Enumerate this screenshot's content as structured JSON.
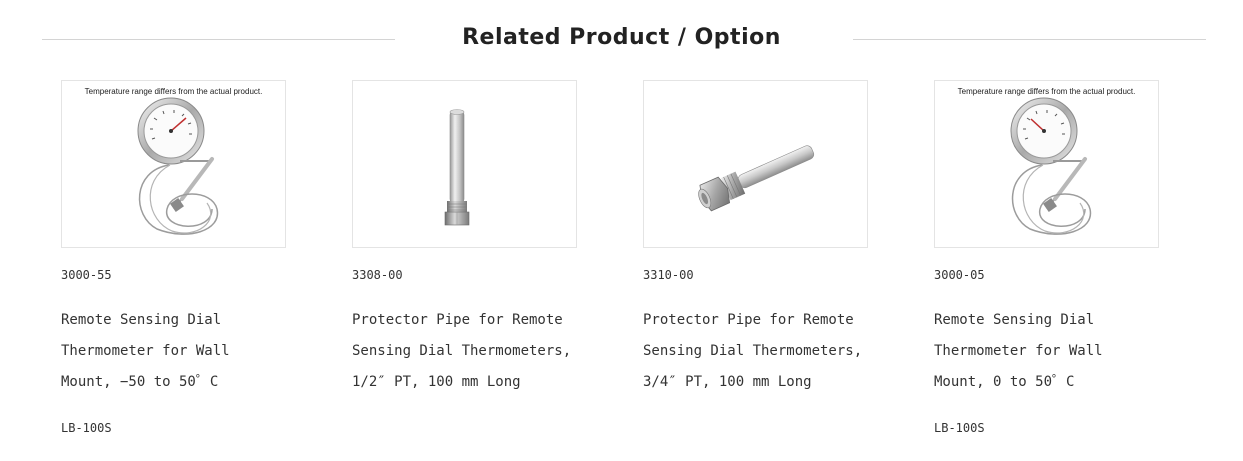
{
  "section": {
    "title": "Related Product / Option"
  },
  "products": [
    {
      "image_note": "Temperature range differs from the actual product.",
      "image_icon": "dial-thermometer-icon",
      "code": "3000-55",
      "name_lines": [
        "Remote Sensing Dial",
        "Thermometer for Wall",
        "Mount, −50 to 50゜C"
      ],
      "sub_label": "LB-100S"
    },
    {
      "image_note": "",
      "image_icon": "protector-pipe-vertical-icon",
      "code": "3308-00",
      "name_lines": [
        "Protector Pipe for Remote",
        "Sensing Dial Thermometers,",
        "1/2″ PT, 100 mm Long"
      ],
      "sub_label": ""
    },
    {
      "image_note": "",
      "image_icon": "protector-pipe-angled-icon",
      "code": "3310-00",
      "name_lines": [
        "Protector Pipe for Remote",
        "Sensing Dial Thermometers,",
        "3/4″ PT, 100 mm Long"
      ],
      "sub_label": ""
    },
    {
      "image_note": "Temperature range differs from the actual product.",
      "image_icon": "dial-thermometer-icon",
      "code": "3000-05",
      "name_lines": [
        "Remote Sensing Dial",
        "Thermometer for Wall",
        "Mount, 0 to 50゜C"
      ],
      "sub_label": "LB-100S"
    }
  ]
}
